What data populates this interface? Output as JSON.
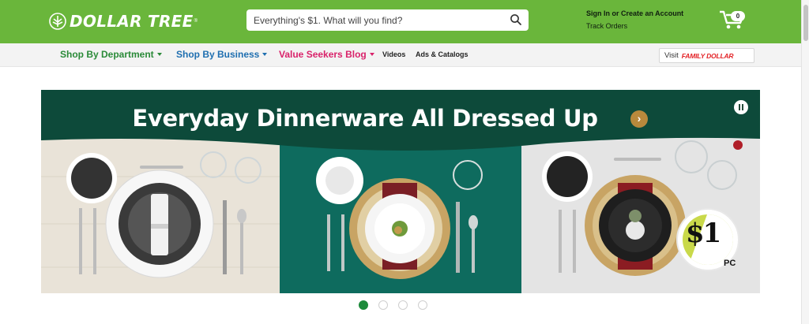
{
  "header": {
    "brand": "DOLLAR TREE",
    "brand_mark": "®",
    "search_placeholder": "Everything's $1. What will you find?",
    "search_icon": "search-icon",
    "account_link": "Sign In or Create an Account",
    "track_orders": "Track Orders",
    "cart_count": "0",
    "cart_icon": "cart-icon"
  },
  "nav": {
    "shop_by_department": "Shop By Department",
    "shop_by_business": "Shop By Business",
    "value_seekers_blog": "Value Seekers Blog",
    "videos": "Videos",
    "ads_catalogs": "Ads & Catalogs",
    "visit": "Visit",
    "family_dollar": "FAMILY DOLLAR"
  },
  "banner": {
    "title": "Everyday Dinnerware All Dressed Up",
    "arrow": "›",
    "price": "$1",
    "price_unit": "PC"
  },
  "carousel": {
    "slides": 4,
    "active_index": 0
  },
  "colors": {
    "header_green": "#6ab63b",
    "banner_green": "#0d4a3a",
    "dept_green": "#2a8a38",
    "business_blue": "#1f6fb0",
    "blog_pink": "#d9226a",
    "family_dollar_red": "#e32226",
    "active_dot": "#1d8a3b"
  }
}
